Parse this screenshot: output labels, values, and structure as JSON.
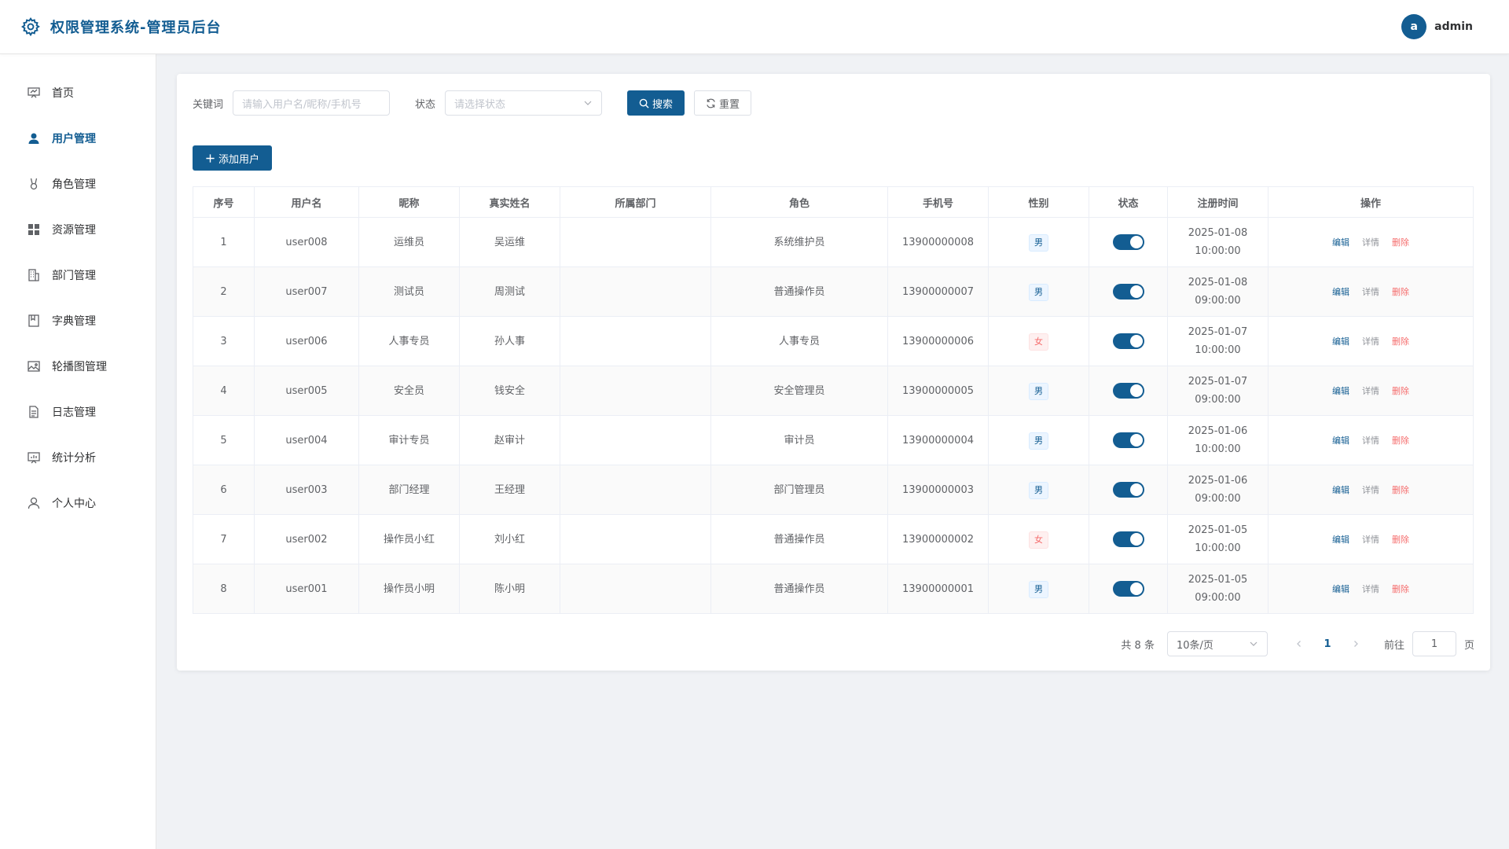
{
  "header": {
    "title": "权限管理系统-管理员后台",
    "avatar_letter": "a",
    "username": "admin"
  },
  "sidebar": {
    "items": [
      {
        "label": "首页",
        "icon": "dashboard-icon",
        "active": false
      },
      {
        "label": "用户管理",
        "icon": "user-icon",
        "active": true
      },
      {
        "label": "角色管理",
        "icon": "role-icon",
        "active": false
      },
      {
        "label": "资源管理",
        "icon": "grid-icon",
        "active": false
      },
      {
        "label": "部门管理",
        "icon": "building-icon",
        "active": false
      },
      {
        "label": "字典管理",
        "icon": "book-icon",
        "active": false
      },
      {
        "label": "轮播图管理",
        "icon": "picture-icon",
        "active": false
      },
      {
        "label": "日志管理",
        "icon": "document-icon",
        "active": false
      },
      {
        "label": "统计分析",
        "icon": "chart-icon",
        "active": false
      },
      {
        "label": "个人中心",
        "icon": "person-icon",
        "active": false
      }
    ]
  },
  "search": {
    "keyword_label": "关键词",
    "keyword_placeholder": "请输入用户名/昵称/手机号",
    "status_label": "状态",
    "status_placeholder": "请选择状态",
    "search_button": "搜索",
    "reset_button": "重置"
  },
  "toolbar": {
    "add_button": "添加用户"
  },
  "table": {
    "columns": [
      "序号",
      "用户名",
      "昵称",
      "真实姓名",
      "所属部门",
      "角色",
      "手机号",
      "性别",
      "状态",
      "注册时间",
      "操作"
    ],
    "rows": [
      {
        "index": "1",
        "username": "user008",
        "nickname": "运维员",
        "realname": "吴运维",
        "dept": "",
        "role": "系统维护员",
        "phone": "13900000008",
        "gender": "男",
        "enabled": true,
        "date": "2025-01-08",
        "time": "10:00:00"
      },
      {
        "index": "2",
        "username": "user007",
        "nickname": "测试员",
        "realname": "周测试",
        "dept": "",
        "role": "普通操作员",
        "phone": "13900000007",
        "gender": "男",
        "enabled": true,
        "date": "2025-01-08",
        "time": "09:00:00"
      },
      {
        "index": "3",
        "username": "user006",
        "nickname": "人事专员",
        "realname": "孙人事",
        "dept": "",
        "role": "人事专员",
        "phone": "13900000006",
        "gender": "女",
        "enabled": true,
        "date": "2025-01-07",
        "time": "10:00:00"
      },
      {
        "index": "4",
        "username": "user005",
        "nickname": "安全员",
        "realname": "钱安全",
        "dept": "",
        "role": "安全管理员",
        "phone": "13900000005",
        "gender": "男",
        "enabled": true,
        "date": "2025-01-07",
        "time": "09:00:00"
      },
      {
        "index": "5",
        "username": "user004",
        "nickname": "审计专员",
        "realname": "赵审计",
        "dept": "",
        "role": "审计员",
        "phone": "13900000004",
        "gender": "男",
        "enabled": true,
        "date": "2025-01-06",
        "time": "10:00:00"
      },
      {
        "index": "6",
        "username": "user003",
        "nickname": "部门经理",
        "realname": "王经理",
        "dept": "",
        "role": "部门管理员",
        "phone": "13900000003",
        "gender": "男",
        "enabled": true,
        "date": "2025-01-06",
        "time": "09:00:00"
      },
      {
        "index": "7",
        "username": "user002",
        "nickname": "操作员小红",
        "realname": "刘小红",
        "dept": "",
        "role": "普通操作员",
        "phone": "13900000002",
        "gender": "女",
        "enabled": true,
        "date": "2025-01-05",
        "time": "10:00:00"
      },
      {
        "index": "8",
        "username": "user001",
        "nickname": "操作员小明",
        "realname": "陈小明",
        "dept": "",
        "role": "普通操作员",
        "phone": "13900000001",
        "gender": "男",
        "enabled": true,
        "date": "2025-01-05",
        "time": "09:00:00"
      }
    ],
    "actions": {
      "edit": "编辑",
      "detail": "详情",
      "delete": "删除"
    }
  },
  "pagination": {
    "total_text": "共 8 条",
    "page_size": "10条/页",
    "current_page": "1",
    "jump_label": "前往",
    "jump_value": "1",
    "page_suffix": "页"
  },
  "colors": {
    "primary": "#135d92",
    "danger": "#f56c6c",
    "background": "#f0f2f5"
  }
}
